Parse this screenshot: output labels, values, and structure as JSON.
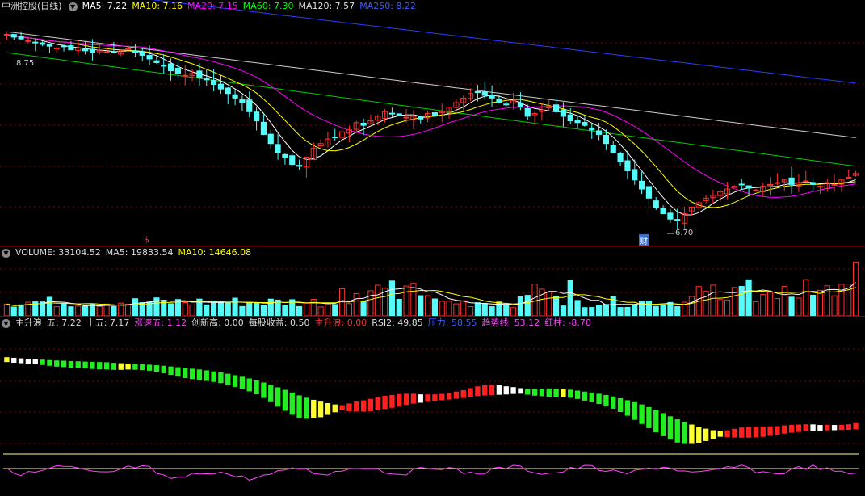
{
  "price_panel": {
    "title": "中洲控股(日线)",
    "indicators": [
      {
        "label": "MA5: 7.22",
        "color": "#ffffff"
      },
      {
        "label": "MA10: 7.16",
        "color": "#ffff00"
      },
      {
        "label": "MA20: 7.15",
        "color": "#ff00ff"
      },
      {
        "label": "MA60: 7.30",
        "color": "#00ff00"
      },
      {
        "label": "MA120: 7.57",
        "color": "#dddddd"
      },
      {
        "label": "MA250: 8.22",
        "color": "#3a5cff"
      }
    ],
    "high_label": "8.75",
    "low_label": "6.70",
    "marker_dollar": "$",
    "marker_cai": "财"
  },
  "volume_panel": {
    "indicators": [
      {
        "label": "VOLUME: 33104.52",
        "color": "#dddddd"
      },
      {
        "label": "MA5: 19833.54",
        "color": "#dddddd"
      },
      {
        "label": "MA10: 14646.08",
        "color": "#ffff00"
      }
    ]
  },
  "indicator_panel": {
    "indicators": [
      {
        "label": "主升浪",
        "color": "#dddddd"
      },
      {
        "label": "五: 7.22",
        "color": "#dddddd"
      },
      {
        "label": "十五: 7.17",
        "color": "#dddddd"
      },
      {
        "label": "涨速五: 1.12",
        "color": "#ff44ff"
      },
      {
        "label": "创新高: 0.00",
        "color": "#dddddd"
      },
      {
        "label": "每股收益: 0.50",
        "color": "#dddddd"
      },
      {
        "label": "主升浪: 0.00",
        "color": "#ff3030"
      },
      {
        "label": "RSI2: 49.85",
        "color": "#dddddd"
      },
      {
        "label": "压力: 58.55",
        "color": "#3a5cff"
      },
      {
        "label": "趋势线: 53.12",
        "color": "#ff44ff"
      },
      {
        "label": "红柱: -8.70",
        "color": "#ff44ff"
      }
    ]
  },
  "chart_data": [
    {
      "type": "candlestick",
      "title": "中洲控股(日线)",
      "series": [
        {
          "name": "MA5",
          "last": 7.22
        },
        {
          "name": "MA10",
          "last": 7.16
        },
        {
          "name": "MA20",
          "last": 7.15
        },
        {
          "name": "MA60",
          "last": 7.3
        },
        {
          "name": "MA120",
          "last": 7.57
        },
        {
          "name": "MA250",
          "last": 8.22
        }
      ],
      "annotations": [
        "8.75",
        "6.70"
      ],
      "closes": [
        8.75,
        8.72,
        8.7,
        8.68,
        8.66,
        8.64,
        8.62,
        8.6,
        8.62,
        8.58,
        8.6,
        8.57,
        8.55,
        8.58,
        8.56,
        8.55,
        8.57,
        8.59,
        8.55,
        8.52,
        8.48,
        8.44,
        8.4,
        8.35,
        8.32,
        8.3,
        8.32,
        8.28,
        8.25,
        8.2,
        8.15,
        8.1,
        8.05,
        8.0,
        7.9,
        7.8,
        7.65,
        7.55,
        7.45,
        7.4,
        7.32,
        7.3,
        7.4,
        7.5,
        7.55,
        7.6,
        7.62,
        7.68,
        7.7,
        7.78,
        7.75,
        7.8,
        7.85,
        7.9,
        7.88,
        7.86,
        7.84,
        7.85,
        7.82,
        7.88,
        7.86,
        7.9,
        7.95,
        8.0,
        8.05,
        8.1,
        8.12,
        8.08,
        8.05,
        8.0,
        7.98,
        8.02,
        7.95,
        7.85,
        7.88,
        7.92,
        7.95,
        7.9,
        7.85,
        7.8,
        7.78,
        7.75,
        7.7,
        7.65,
        7.55,
        7.45,
        7.35,
        7.25,
        7.15,
        7.05,
        6.95,
        6.85,
        6.78,
        6.72,
        6.7,
        6.78,
        6.85,
        6.9,
        6.95,
        6.98,
        7.02,
        7.05,
        7.08,
        7.1,
        7.06,
        7.04,
        7.08,
        7.1,
        7.12,
        7.15,
        7.1,
        7.12,
        7.14,
        7.1,
        7.08,
        7.12,
        7.1,
        7.15,
        7.18,
        7.22
      ]
    },
    {
      "type": "bar",
      "title": "VOLUME",
      "series": [
        {
          "name": "VOLUME",
          "last": 33104.52
        },
        {
          "name": "MA5",
          "last": 19833.54
        },
        {
          "name": "MA10",
          "last": 14646.08
        }
      ]
    },
    {
      "type": "bar",
      "title": "主升浪",
      "series": [
        {
          "name": "五",
          "last": 7.22
        },
        {
          "name": "十五",
          "last": 7.17
        },
        {
          "name": "RSI2",
          "last": 49.85
        },
        {
          "name": "压力",
          "last": 58.55
        },
        {
          "name": "趋势线",
          "last": 53.12
        },
        {
          "name": "红柱",
          "last": -8.7
        }
      ]
    }
  ]
}
